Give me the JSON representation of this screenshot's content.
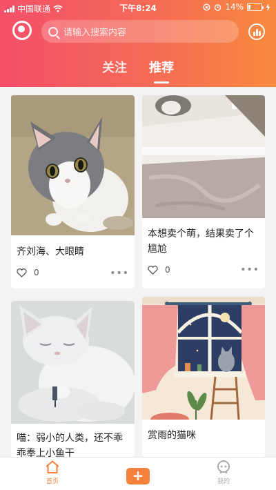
{
  "status_bar": {
    "carrier": "中国联通",
    "time": "下午8:24",
    "battery": "14%",
    "battery_level": 0.14
  },
  "header": {
    "search_placeholder": "请输入搜索内容",
    "tabs": [
      {
        "label": "关注",
        "active": false
      },
      {
        "label": "推荐",
        "active": true
      }
    ],
    "accent_start": "#f4506a",
    "accent_end": "#f88a3e"
  },
  "feed": [
    {
      "title": "齐刘海、大眼睛",
      "likes": "0"
    },
    {
      "title": "本想卖个萌，结果卖了个尴尬",
      "likes": "0"
    },
    {
      "title": "喵：弱小的人类，还不乖乖奉上小鱼干",
      "likes": ""
    },
    {
      "title": "赏雨的猫咪",
      "likes": ""
    }
  ],
  "bottom_nav": {
    "home_label": "首页",
    "add_label": "+",
    "me_label": "我的",
    "active_color": "#f5813e"
  }
}
